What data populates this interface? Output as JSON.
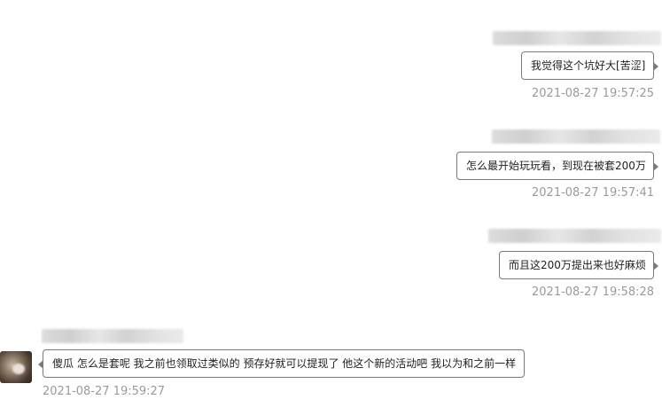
{
  "messages": [
    {
      "side": "right",
      "text": "我觉得这个坑好大[苦涩]",
      "time": "2021-08-27 19:57:25"
    },
    {
      "side": "right",
      "text": "怎么最开始玩玩看，到现在被套200万",
      "time": "2021-08-27 19:57:41"
    },
    {
      "side": "right",
      "text": "而且这200万提出来也好麻烦",
      "time": "2021-08-27 19:58:28"
    },
    {
      "side": "left",
      "text": "傻瓜 怎么是套呢 我之前也领取过类似的 预存好就可以提现了 他这个新的活动吧 我以为和之前一样",
      "time": "2021-08-27 19:59:27"
    }
  ]
}
